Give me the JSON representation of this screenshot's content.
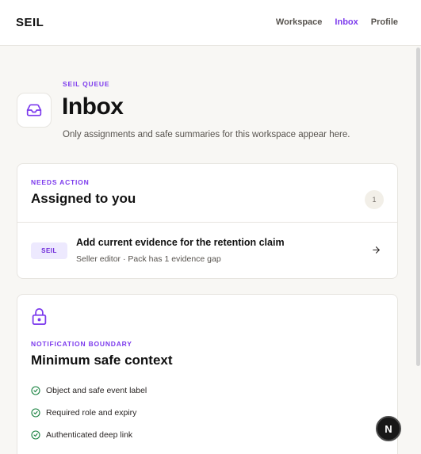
{
  "header": {
    "logo": "SEIL",
    "nav": [
      "Workspace",
      "Inbox",
      "Profile"
    ],
    "active_nav": "Inbox"
  },
  "hero": {
    "eyebrow": "SEIL QUEUE",
    "title": "Inbox",
    "description": "Only assignments and safe summaries for this workspace appear here.",
    "icon": "inbox-icon"
  },
  "assigned_card": {
    "eyebrow": "NEEDS ACTION",
    "title": "Assigned to you",
    "count": "1",
    "items": [
      {
        "tag": "SEIL",
        "title": "Add current evidence for the retention claim",
        "subtitle": "Seller editor · Pack has 1 evidence gap",
        "icon": "arrow-right-icon"
      }
    ]
  },
  "boundary_card": {
    "icon": "lock-icon",
    "eyebrow": "NOTIFICATION BOUNDARY",
    "title": "Minimum safe context",
    "checks": [
      "Object and safe event label",
      "Required role and expiry",
      "Authenticated deep link"
    ]
  },
  "fab": {
    "label": "N"
  },
  "colors": {
    "accent": "#7c3aed",
    "check": "#15803d",
    "background": "#f8f7f4"
  }
}
